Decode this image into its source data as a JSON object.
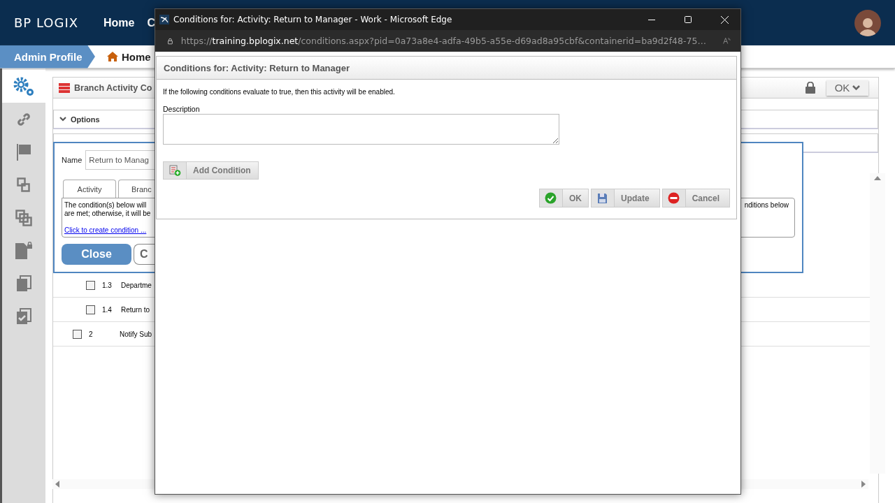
{
  "header": {
    "logo": "BP LOGIX",
    "nav": [
      "Home",
      "C"
    ]
  },
  "breadcrumb": {
    "profile": "Admin Profile",
    "home": "Home"
  },
  "sidebar": {
    "items": [
      {
        "kind": "gear",
        "selected": true
      },
      {
        "kind": "link",
        "selected": false
      },
      {
        "kind": "flag",
        "selected": false
      },
      {
        "kind": "squares",
        "selected": false
      },
      {
        "kind": "layers",
        "selected": false
      },
      {
        "kind": "doclock",
        "selected": false
      },
      {
        "kind": "copies",
        "selected": false
      },
      {
        "kind": "check",
        "selected": false
      }
    ]
  },
  "panel": {
    "title": "Branch Activity Co",
    "ok_button": "OK",
    "sections": [
      {
        "label": "Options",
        "expanded": true
      }
    ]
  },
  "editor": {
    "name_label": "Name",
    "name_value": "Return to Manag",
    "tabs": [
      {
        "label": "Activity"
      },
      {
        "label": "Branc"
      }
    ],
    "condition_text_left": [
      "The condition(s) below will",
      "are met; otherwise, it will be"
    ],
    "condition_text_right": "nditions below",
    "link": "Click to create condition ...",
    "close_button": "Close",
    "second_button": "C"
  },
  "rows": [
    {
      "kind": "sub",
      "number": "1.3",
      "name": "Departme",
      "checked": false
    },
    {
      "kind": "sub",
      "number": "1.4",
      "name": "Return to",
      "checked": false
    },
    {
      "kind": "main",
      "number": "2",
      "name": "Notify Sub",
      "checked": false
    }
  ],
  "popup": {
    "window_title": "Conditions for: Activity: Return to Manager - Work - Microsoft Edge",
    "url_scheme": "https://",
    "url_domain": "training.bplogix.net",
    "url_rest": "/conditions.aspx?pid=0a73a8e4-adfa-49b5-a55e-d69ad8a95cbf&containerid=ba9d2f48-75…",
    "panel_title": "Conditions for: Activity: Return to Manager",
    "intro": "If the following conditions evaluate to true, then this activity will be enabled.",
    "description_label": "Description",
    "add_button": "Add Condition",
    "buttons": [
      {
        "kind": "ok",
        "label": "OK"
      },
      {
        "kind": "update",
        "label": "Update"
      },
      {
        "kind": "cancel",
        "label": "Cancel"
      }
    ]
  }
}
